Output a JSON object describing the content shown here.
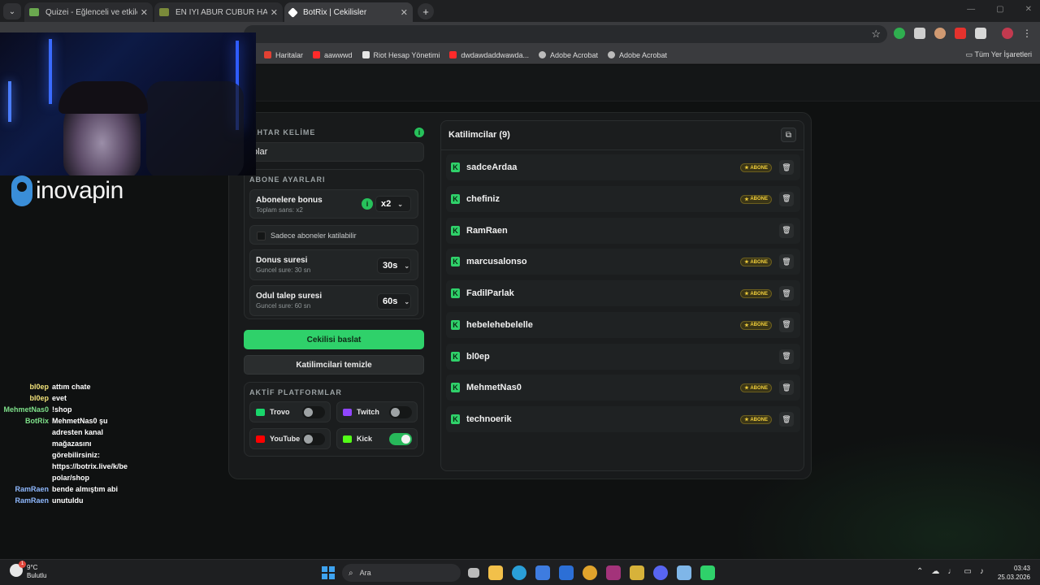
{
  "browser": {
    "tabs": [
      {
        "title": "Quizei - Eğlenceli ve etkileşimli",
        "active": false,
        "favicon_color": "#6aa84f"
      },
      {
        "title": "EN İYİ ABUR CUBUR HANGİSİ?",
        "active": false,
        "favicon_color": "#7a8a3a"
      },
      {
        "title": "BotRix | Cekilisler",
        "active": true,
        "favicon_color": "#ffffff"
      }
    ],
    "new_tab": "+",
    "bookmarks": [
      {
        "label": "Haritalar",
        "icon_color": "#e34133"
      },
      {
        "label": "aawwwd",
        "icon_color": "#ff2a2a"
      },
      {
        "label": "Riot Hesap Yönetimi",
        "icon_color": "#e6e6e6"
      },
      {
        "label": "dwdawdaddwawda...",
        "icon_color": "#ff2a2a"
      },
      {
        "label": "Adobe Acrobat",
        "icon_color": "#bbbbbb"
      },
      {
        "label": "Adobe Acrobat",
        "icon_color": "#bbbbbb"
      }
    ],
    "all_bookmarks": "Tüm Yer İşaretleri"
  },
  "raffle": {
    "keyword_label": "AHTAR KELİME",
    "keyword_value": "olar",
    "subscriber_settings_title": "ABONE AYARLARI",
    "sub_bonus": {
      "title": "Abonelere bonus",
      "subtitle": "Toplam sans: x2",
      "value": "x2"
    },
    "only_subs_label": "Sadece aboneler katilabilir",
    "bonus_time": {
      "title": "Donus suresi",
      "subtitle": "Guncel sure: 30 sn",
      "value": "30s"
    },
    "claim_time": {
      "title": "Odul talep suresi",
      "subtitle": "Guncel sure: 60 sn",
      "value": "60s"
    },
    "start_button": "Cekilisi baslat",
    "clear_button": "Katilimcilari temizle",
    "platforms_title": "AKTİF PLATFORMLAR",
    "platforms": [
      {
        "name": "Trovo",
        "enabled": false,
        "color": "#19d66b"
      },
      {
        "name": "Twitch",
        "enabled": false,
        "color": "#9146ff"
      },
      {
        "name": "YouTube",
        "enabled": false,
        "color": "#ff0000"
      },
      {
        "name": "Kick",
        "enabled": true,
        "color": "#53fc18"
      }
    ],
    "info_glyph": "i"
  },
  "participants": {
    "header": "Katilimcilar (9)",
    "sub_badge": "ABONE",
    "list": [
      {
        "name": "sadceArdaa",
        "subscriber": true
      },
      {
        "name": "chefiniz",
        "subscriber": true
      },
      {
        "name": "RamRaen",
        "subscriber": false
      },
      {
        "name": "marcusalonso",
        "subscriber": true
      },
      {
        "name": "FadilParlak",
        "subscriber": true
      },
      {
        "name": "hebelehebelelle",
        "subscriber": true
      },
      {
        "name": "bl0ep",
        "subscriber": false
      },
      {
        "name": "MehmetNas0",
        "subscriber": true
      },
      {
        "name": "technoerik",
        "subscriber": true
      }
    ]
  },
  "overlay": {
    "brand": "inovapin"
  },
  "chat": [
    {
      "user": "bl0ep",
      "text": "attım chate",
      "color": "#f2e27a"
    },
    {
      "user": "bl0ep",
      "text": "evet",
      "color": "#f2e27a"
    },
    {
      "user": "MehmetNas0",
      "text": "!shop",
      "color": "#7ee08a"
    },
    {
      "user": "BotRix",
      "text": "MehmetNas0 şu adresten kanal mağazasını görebilirsiniz: https://botrix.live/k/be polar/shop",
      "color": "#7ee08a"
    },
    {
      "user": "RamRaen",
      "text": "bende almıştım abi",
      "color": "#8fb9ff"
    },
    {
      "user": "RamRaen",
      "text": "unutuldu",
      "color": "#8fb9ff"
    }
  ],
  "taskbar": {
    "temp": "9°C",
    "weather": "Bulutlu",
    "weather_badge": "1",
    "search_placeholder": "Ara",
    "time": "03:43",
    "date": "25.03.2026"
  }
}
